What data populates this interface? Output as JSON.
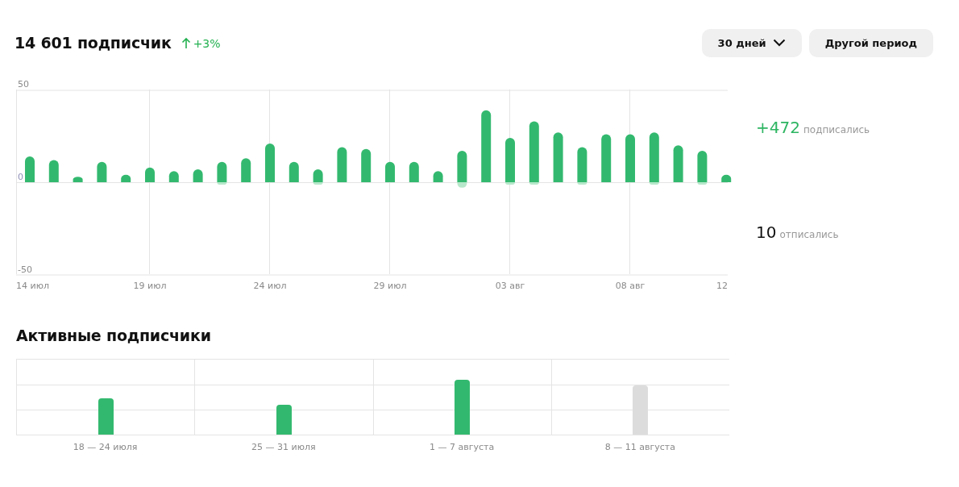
{
  "header": {
    "title": "14 601 подписчик",
    "trend": {
      "text": "+3%"
    }
  },
  "period_buttons": [
    {
      "kind": "dropdown",
      "label": "30 дней"
    },
    {
      "kind": "plain",
      "label": "Другой период"
    }
  ],
  "subscribers_chart": {
    "chart_data": {
      "type": "bar",
      "categories": [
        "14 июл",
        null,
        null,
        null,
        null,
        "19 июл",
        null,
        null,
        null,
        null,
        "24 июл",
        null,
        null,
        null,
        null,
        "29 июл",
        null,
        null,
        null,
        null,
        "03 авг",
        null,
        null,
        null,
        null,
        "08 авг",
        null,
        null,
        null,
        "12"
      ],
      "series": [
        {
          "name": "подписались",
          "color": "#33b96f",
          "values": [
            14,
            12,
            3,
            11,
            4,
            8,
            6,
            7,
            11,
            13,
            21,
            11,
            7,
            19,
            18,
            11,
            11,
            6,
            17,
            39,
            24,
            33,
            27,
            19,
            26,
            26,
            27,
            20,
            17,
            4
          ]
        },
        {
          "name": "отписались",
          "color": "#b7e7ca",
          "values": [
            0,
            0,
            0,
            0,
            0,
            0,
            0,
            0,
            -1,
            0,
            0,
            0,
            -1,
            0,
            0,
            0,
            0,
            0,
            -3,
            0,
            -1,
            -1,
            0,
            -1,
            0,
            0,
            -1,
            0,
            -1,
            0
          ]
        }
      ],
      "ylim": [
        -50,
        50
      ],
      "yticks": [
        {
          "value": 50,
          "label": "50"
        },
        {
          "value": 0,
          "label": "0"
        },
        {
          "value": -50,
          "label": "-50"
        }
      ],
      "stacked": true,
      "grid": true
    }
  },
  "stats": [
    {
      "kind": "gain",
      "value": "+472"
    },
    {
      "kind": "loss",
      "value": "10"
    }
  ],
  "active_subscribers": {
    "title": "Активные подписчики",
    "weeks": [
      {
        "label": "18 — 24 июля",
        "kind": "complete"
      },
      {
        "label": "25 — 31 июля",
        "kind": "complete"
      },
      {
        "label": "1 — 7 августа",
        "kind": "complete"
      },
      {
        "label": "8 — 11 августа",
        "kind": "current"
      }
    ]
  }
}
